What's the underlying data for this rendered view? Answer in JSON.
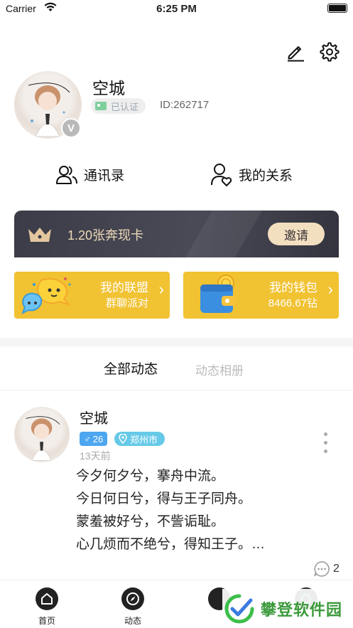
{
  "status_bar": {
    "carrier": "Carrier",
    "time": "6:25 PM"
  },
  "profile": {
    "name": "空城",
    "verify_label": "已认证",
    "id_text": "ID:262717",
    "avatar_badge": "V"
  },
  "quick_links": {
    "contacts": "通讯录",
    "relations": "我的关系"
  },
  "banner": {
    "text": "1.20张奔现卡",
    "invite_label": "邀请"
  },
  "cards": {
    "alliance": {
      "title": "我的联盟",
      "subtitle": "群聊派对"
    },
    "wallet": {
      "title": "我的钱包",
      "subtitle": "8466.67钻"
    }
  },
  "feed_tabs": {
    "all": "全部动态",
    "album": "动态相册"
  },
  "post": {
    "author": "空城",
    "age": "26",
    "location": "郑州市",
    "time": "13天前",
    "lines": [
      "今夕何夕兮，搴舟中流。",
      "今日何日兮，得与王子同舟。",
      "蒙羞被好兮，不訾诟耻。",
      "心几烦而不绝兮，得知王子。…"
    ],
    "comment_count": "2"
  },
  "tab_bar": {
    "home": "首页",
    "feed": "动态"
  },
  "watermark": "攀登软件园",
  "colors": {
    "gold_card": "#f1c232",
    "banner_dark": "#3c3c48",
    "banner_gold": "#ecd9b8",
    "gender_blue": "#4da6f0",
    "location_cyan": "#66c9e8"
  }
}
